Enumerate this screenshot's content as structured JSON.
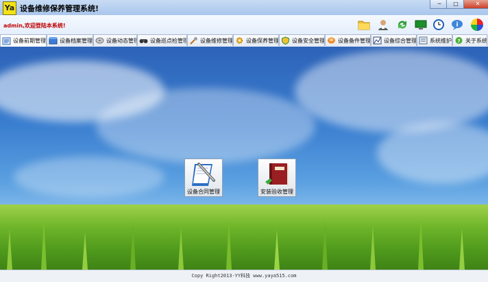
{
  "window": {
    "logo_text": "Ya",
    "title": "设备维修保养管理系统!",
    "controls": [
      "─",
      "□",
      "✕"
    ]
  },
  "header": {
    "welcome": "admin,欢迎登陆本系统!",
    "icons": [
      "folder-icon",
      "user-icon",
      "refresh-icon",
      "monitor-icon",
      "clock-icon",
      "info-icon",
      "color-icon"
    ]
  },
  "tabs": [
    {
      "label": "设备前期管理",
      "icon": "document-icon"
    },
    {
      "label": "设备档案管理",
      "icon": "archive-box-icon"
    },
    {
      "label": "设备动态管理",
      "icon": "disk-icon"
    },
    {
      "label": "设备巡点检管理",
      "icon": "binoculars-icon"
    },
    {
      "label": "设备维修管理",
      "icon": "wrench-icon"
    },
    {
      "label": "设备保养管理",
      "icon": "gear-icon"
    },
    {
      "label": "设备安全管理",
      "icon": "shield-icon"
    },
    {
      "label": "设备备件管理",
      "icon": "parts-icon"
    },
    {
      "label": "设备综合管理",
      "icon": "chart-icon"
    },
    {
      "label": "系统维护",
      "icon": "settings-icon"
    },
    {
      "label": "关于系统",
      "icon": "about-icon"
    }
  ],
  "modules": [
    {
      "label": "设备合同管理",
      "icon": "contract-pen-icon"
    },
    {
      "label": "安装验收管理",
      "icon": "red-book-icon"
    }
  ],
  "statusbar": {
    "text": "Copy Right2013-YY科技  www.yaya515.com"
  }
}
